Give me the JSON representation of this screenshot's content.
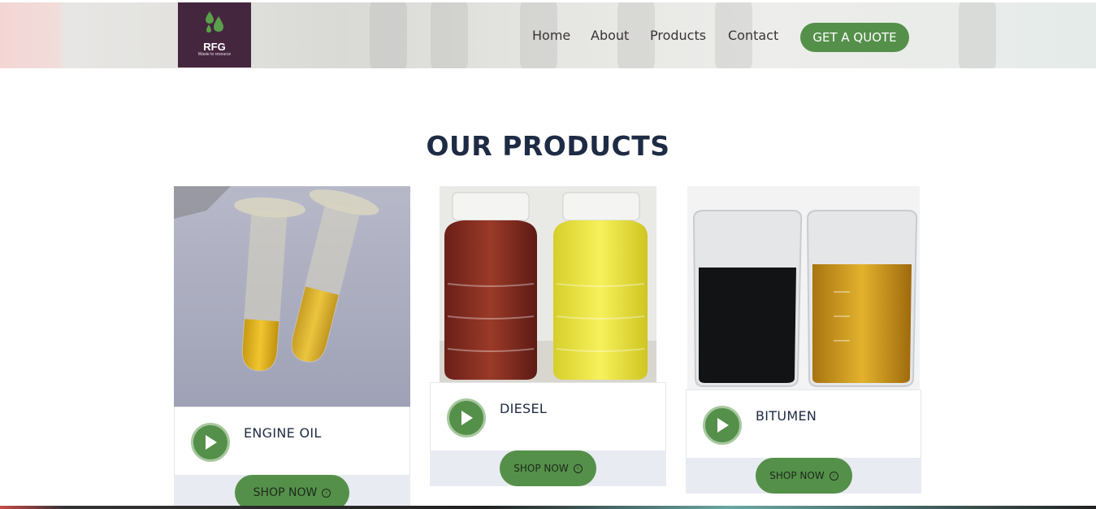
{
  "header": {
    "logo": {
      "text": "RFG",
      "tagline": "Waste to resource"
    },
    "nav": [
      {
        "label": "Home"
      },
      {
        "label": "About"
      },
      {
        "label": "Products"
      },
      {
        "label": "Contact"
      }
    ],
    "quote_button": "GET A QUOTE"
  },
  "section": {
    "title": "OUR PRODUCTS"
  },
  "products": [
    {
      "name": "ENGINE OIL",
      "button": "SHOP NOW",
      "image": "two-test-tubes-yellow-oil"
    },
    {
      "name": "DIESEL",
      "button": "SHOP NOW",
      "image": "red-and-yellow-fuel-bottles"
    },
    {
      "name": "BITUMEN",
      "button": "SHOP NOW",
      "image": "black-and-amber-beakers"
    }
  ],
  "colors": {
    "brand_green": "#55904a",
    "logo_purple": "#45263f",
    "heading_navy": "#1e2b44"
  },
  "icons": {
    "play": "play-icon",
    "arrow": "arrow-right-circle-icon",
    "logo_drops": "oil-drops-icon"
  }
}
